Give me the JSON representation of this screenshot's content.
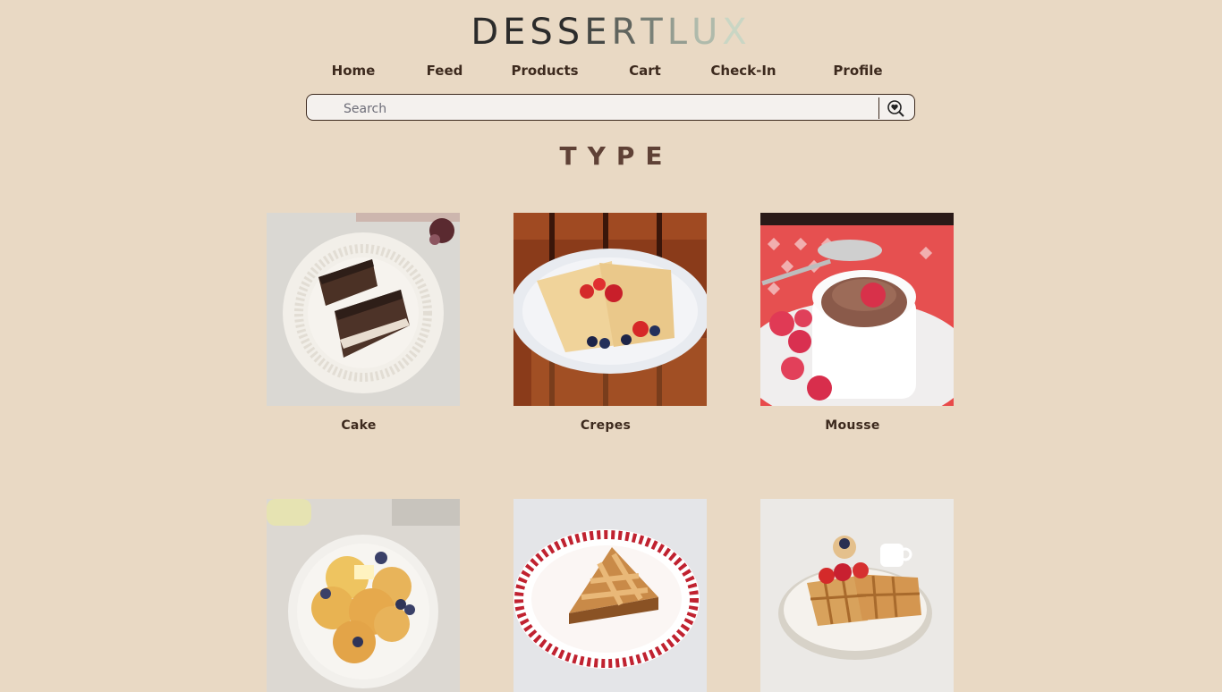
{
  "brand": {
    "logo_text": "DESSERTLUX"
  },
  "nav": {
    "items": [
      {
        "label": "Home"
      },
      {
        "label": "Feed"
      },
      {
        "label": "Products"
      },
      {
        "label": "Cart"
      },
      {
        "label": "Check-In"
      },
      {
        "label": "Profile"
      }
    ]
  },
  "search": {
    "placeholder": "Search",
    "value": "",
    "button_icon": "search-heart-icon"
  },
  "section": {
    "title": "TYPE"
  },
  "categories": [
    {
      "label": "Cake"
    },
    {
      "label": "Crepes"
    },
    {
      "label": "Mousse"
    },
    {
      "label": ""
    },
    {
      "label": ""
    },
    {
      "label": ""
    }
  ],
  "colors": {
    "background": "#e9d9c4",
    "text": "#3d2a1e",
    "heading": "#5f4136",
    "logo_dark": "#2b2b2b",
    "logo_light": "#c9d6c4"
  }
}
